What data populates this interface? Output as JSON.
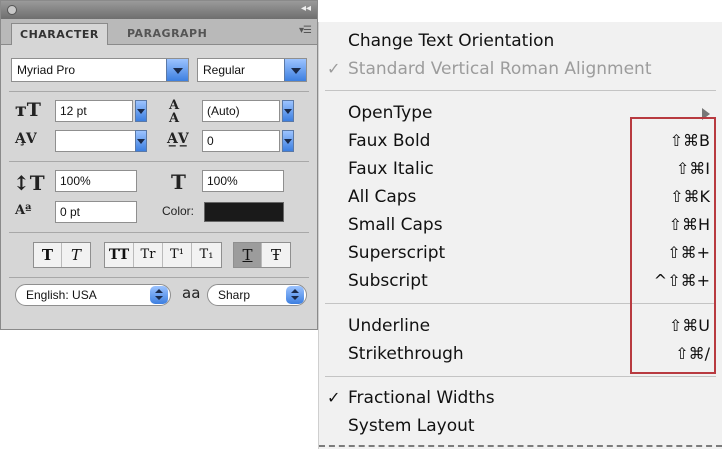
{
  "panel": {
    "tabs": {
      "character": "CHARACTER",
      "paragraph": "PARAGRAPH"
    },
    "font_family": "Myriad Pro",
    "font_style": "Regular",
    "font_size": "12 pt",
    "leading": "(Auto)",
    "kerning": "",
    "tracking": "0",
    "vertical_scale": "100%",
    "horizontal_scale": "100%",
    "baseline_shift": "0 pt",
    "color_label": "Color:",
    "color_value": "#1a1a1a",
    "language": "English: USA",
    "antialias_glyph": "aa",
    "antialias": "Sharp",
    "style_buttons": [
      "T",
      "T",
      "TT",
      "Tr",
      "T¹",
      "T₁",
      "T",
      "Ŧ"
    ],
    "accent_color": "#3d7fe0"
  },
  "menu": {
    "header_items": [
      {
        "label": "Change Text Orientation"
      },
      {
        "label": "Standard Vertical Roman Alignment",
        "checked": true,
        "disabled": true
      }
    ],
    "opentype": {
      "label": "OpenType"
    },
    "style_items": [
      {
        "label": "Faux Bold",
        "shortcut": "⇧⌘B"
      },
      {
        "label": "Faux Italic",
        "shortcut": "⇧⌘I"
      },
      {
        "label": "All Caps",
        "shortcut": "⇧⌘K"
      },
      {
        "label": "Small Caps",
        "shortcut": "⇧⌘H"
      },
      {
        "label": "Superscript",
        "shortcut": "⇧⌘+"
      },
      {
        "label": "Subscript",
        "shortcut": "^⇧⌘+"
      }
    ],
    "line_items": [
      {
        "label": "Underline",
        "shortcut": "⇧⌘U"
      },
      {
        "label": "Strikethrough",
        "shortcut": "⇧⌘/"
      }
    ],
    "bottom_items": [
      {
        "label": "Fractional Widths",
        "checked": true
      },
      {
        "label": "System Layout"
      }
    ],
    "check_glyph": "✓",
    "highlight_color": "#b83a40"
  }
}
